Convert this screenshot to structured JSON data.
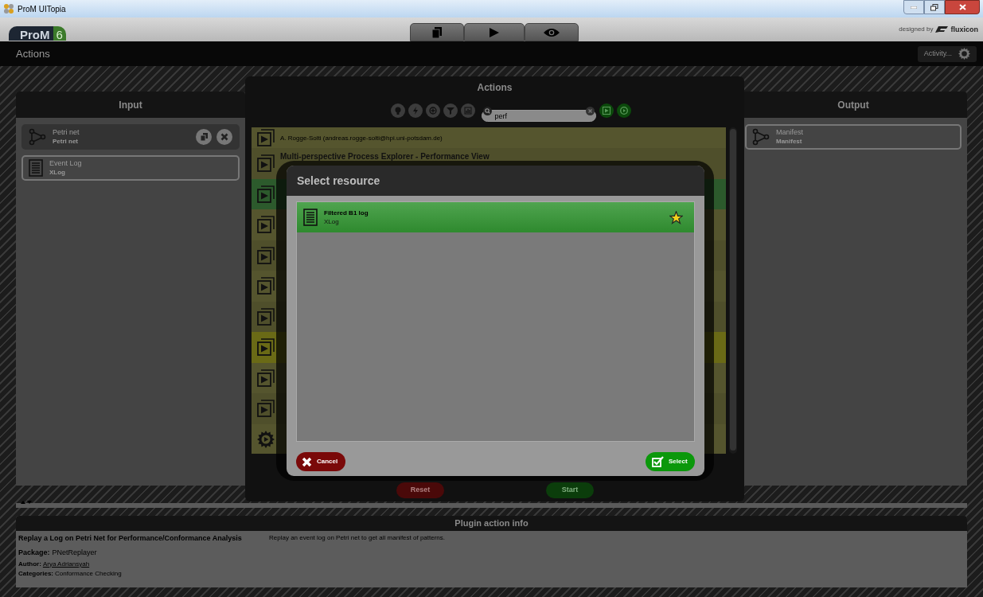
{
  "window": {
    "title": "ProM UITopia"
  },
  "header": {
    "logo": "ProM",
    "logo_version": "6",
    "designed_by": "designed by",
    "brand": "fluxicon"
  },
  "actions_bar": {
    "title": "Actions",
    "activity_button": "Activity..."
  },
  "input_panel": {
    "title": "Input",
    "items": [
      {
        "name": "Petri net",
        "type": "Petri net",
        "kind": "petri",
        "assigned": true
      },
      {
        "name": "Event Log",
        "type": "XLog",
        "kind": "log",
        "assigned": false
      }
    ]
  },
  "output_panel": {
    "title": "Output",
    "items": [
      {
        "name": "Manifest",
        "type": "Manifest",
        "kind": "petri",
        "assigned": false
      }
    ]
  },
  "actions_dialog": {
    "title": "Actions",
    "search": {
      "value": "perf"
    },
    "rows": [
      {
        "kind": "visualizer",
        "color": "#55552e",
        "author": "A. Rogge-Solti (andreas.rogge-solti@hpi.uni-potsdam.de)"
      },
      {
        "kind": "visualizer",
        "color": "#4f4f2b",
        "title": "Multi-perspective Process Explorer - Performance View"
      },
      {
        "kind": "visualizer",
        "color": "#2c5a2c"
      },
      {
        "kind": "visualizer",
        "color": "#55552e"
      },
      {
        "kind": "visualizer",
        "color": "#4f4f2b"
      },
      {
        "kind": "visualizer",
        "color": "#55552e"
      },
      {
        "kind": "visualizer",
        "color": "#4f4f2b"
      },
      {
        "kind": "visualizer",
        "color": "#6a6a16"
      },
      {
        "kind": "visualizer",
        "color": "#55552e"
      },
      {
        "kind": "visualizer",
        "color": "#4f4f2b"
      },
      {
        "kind": "plugin",
        "color": "#55552e"
      }
    ],
    "buttons": [
      {
        "label": "Reset",
        "kind": "cancel"
      },
      {
        "label": "Start",
        "kind": "confirm"
      }
    ]
  },
  "resource_dialog": {
    "title": "Select resource",
    "items": [
      {
        "name": "Filtered B1 log",
        "type": "XLog",
        "selected": true,
        "favorite": true
      }
    ],
    "buttons": [
      {
        "label": "Cancel",
        "kind": "cancel"
      },
      {
        "label": "Select",
        "kind": "confirm"
      }
    ]
  },
  "plugin_info": {
    "title": "Plugin action info",
    "name": "Replay a Log on Petri Net for Performance/Conformance Analysis",
    "package_label": "Package:",
    "package": "PNetReplayer",
    "author_label": "Author:",
    "author": "Arya Adriansyah",
    "categories_label": "Categories:",
    "categories": "Conformance Checking",
    "description": "Replay an event log on Petri net to get all manifest of patterns."
  }
}
